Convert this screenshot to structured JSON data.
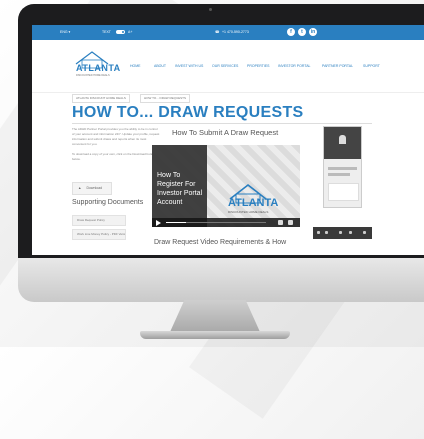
{
  "topbar": {
    "left_items": [
      "ENG ▾",
      "TEXT",
      "A+"
    ],
    "phone_text": "+1 470-590-2773",
    "social": [
      "f",
      "t",
      "in"
    ]
  },
  "header": {
    "logo_text": "ATLANTA",
    "logo_subtext": "DISCOUNTED HOME DEALS",
    "nav": [
      "HOME",
      "ABOUT",
      "INVEST WITH US",
      "OUR SERVICES",
      "PROPERTIES",
      "INVESTOR PORTAL",
      "PARTNER PORTAL",
      "SUPPORT"
    ]
  },
  "breadcrumbs": [
    "ATLANTA DISCOUNT HOME DEALS",
    "HOW TO... DRAW REQUESTS"
  ],
  "page_title": "HOW TO... DRAW REQUESTS",
  "intro_text": "The ADHD Partner Portal provides you the ability to be in control of your account and information 24/7. Update your profile, request information and submit draws and reports when its most convenient for you.",
  "intro_text_2": "To download a copy of your own, click on the Download button below.",
  "download_button": "Download",
  "supporting_docs_heading": "Supporting Documents",
  "docs": [
    "Draw Request Policy",
    "Work Line Money Policy - PDF Version"
  ],
  "video_section": {
    "title": "How To Submit A Draw Request",
    "overlay_text": "How To Register For Investor Portal Account",
    "logo_text": "ATLANTA",
    "logo_subtext": "DISCOUNTED HOME DEALS",
    "below_heading": "Draw Request Video Requirements & How"
  },
  "sidebar_controls": [
    "🔍",
    "⊞",
    "‹",
    "›",
    "⤢"
  ],
  "colors": {
    "brand_blue": "#2a7fc0",
    "dark": "#1c1c1e"
  }
}
